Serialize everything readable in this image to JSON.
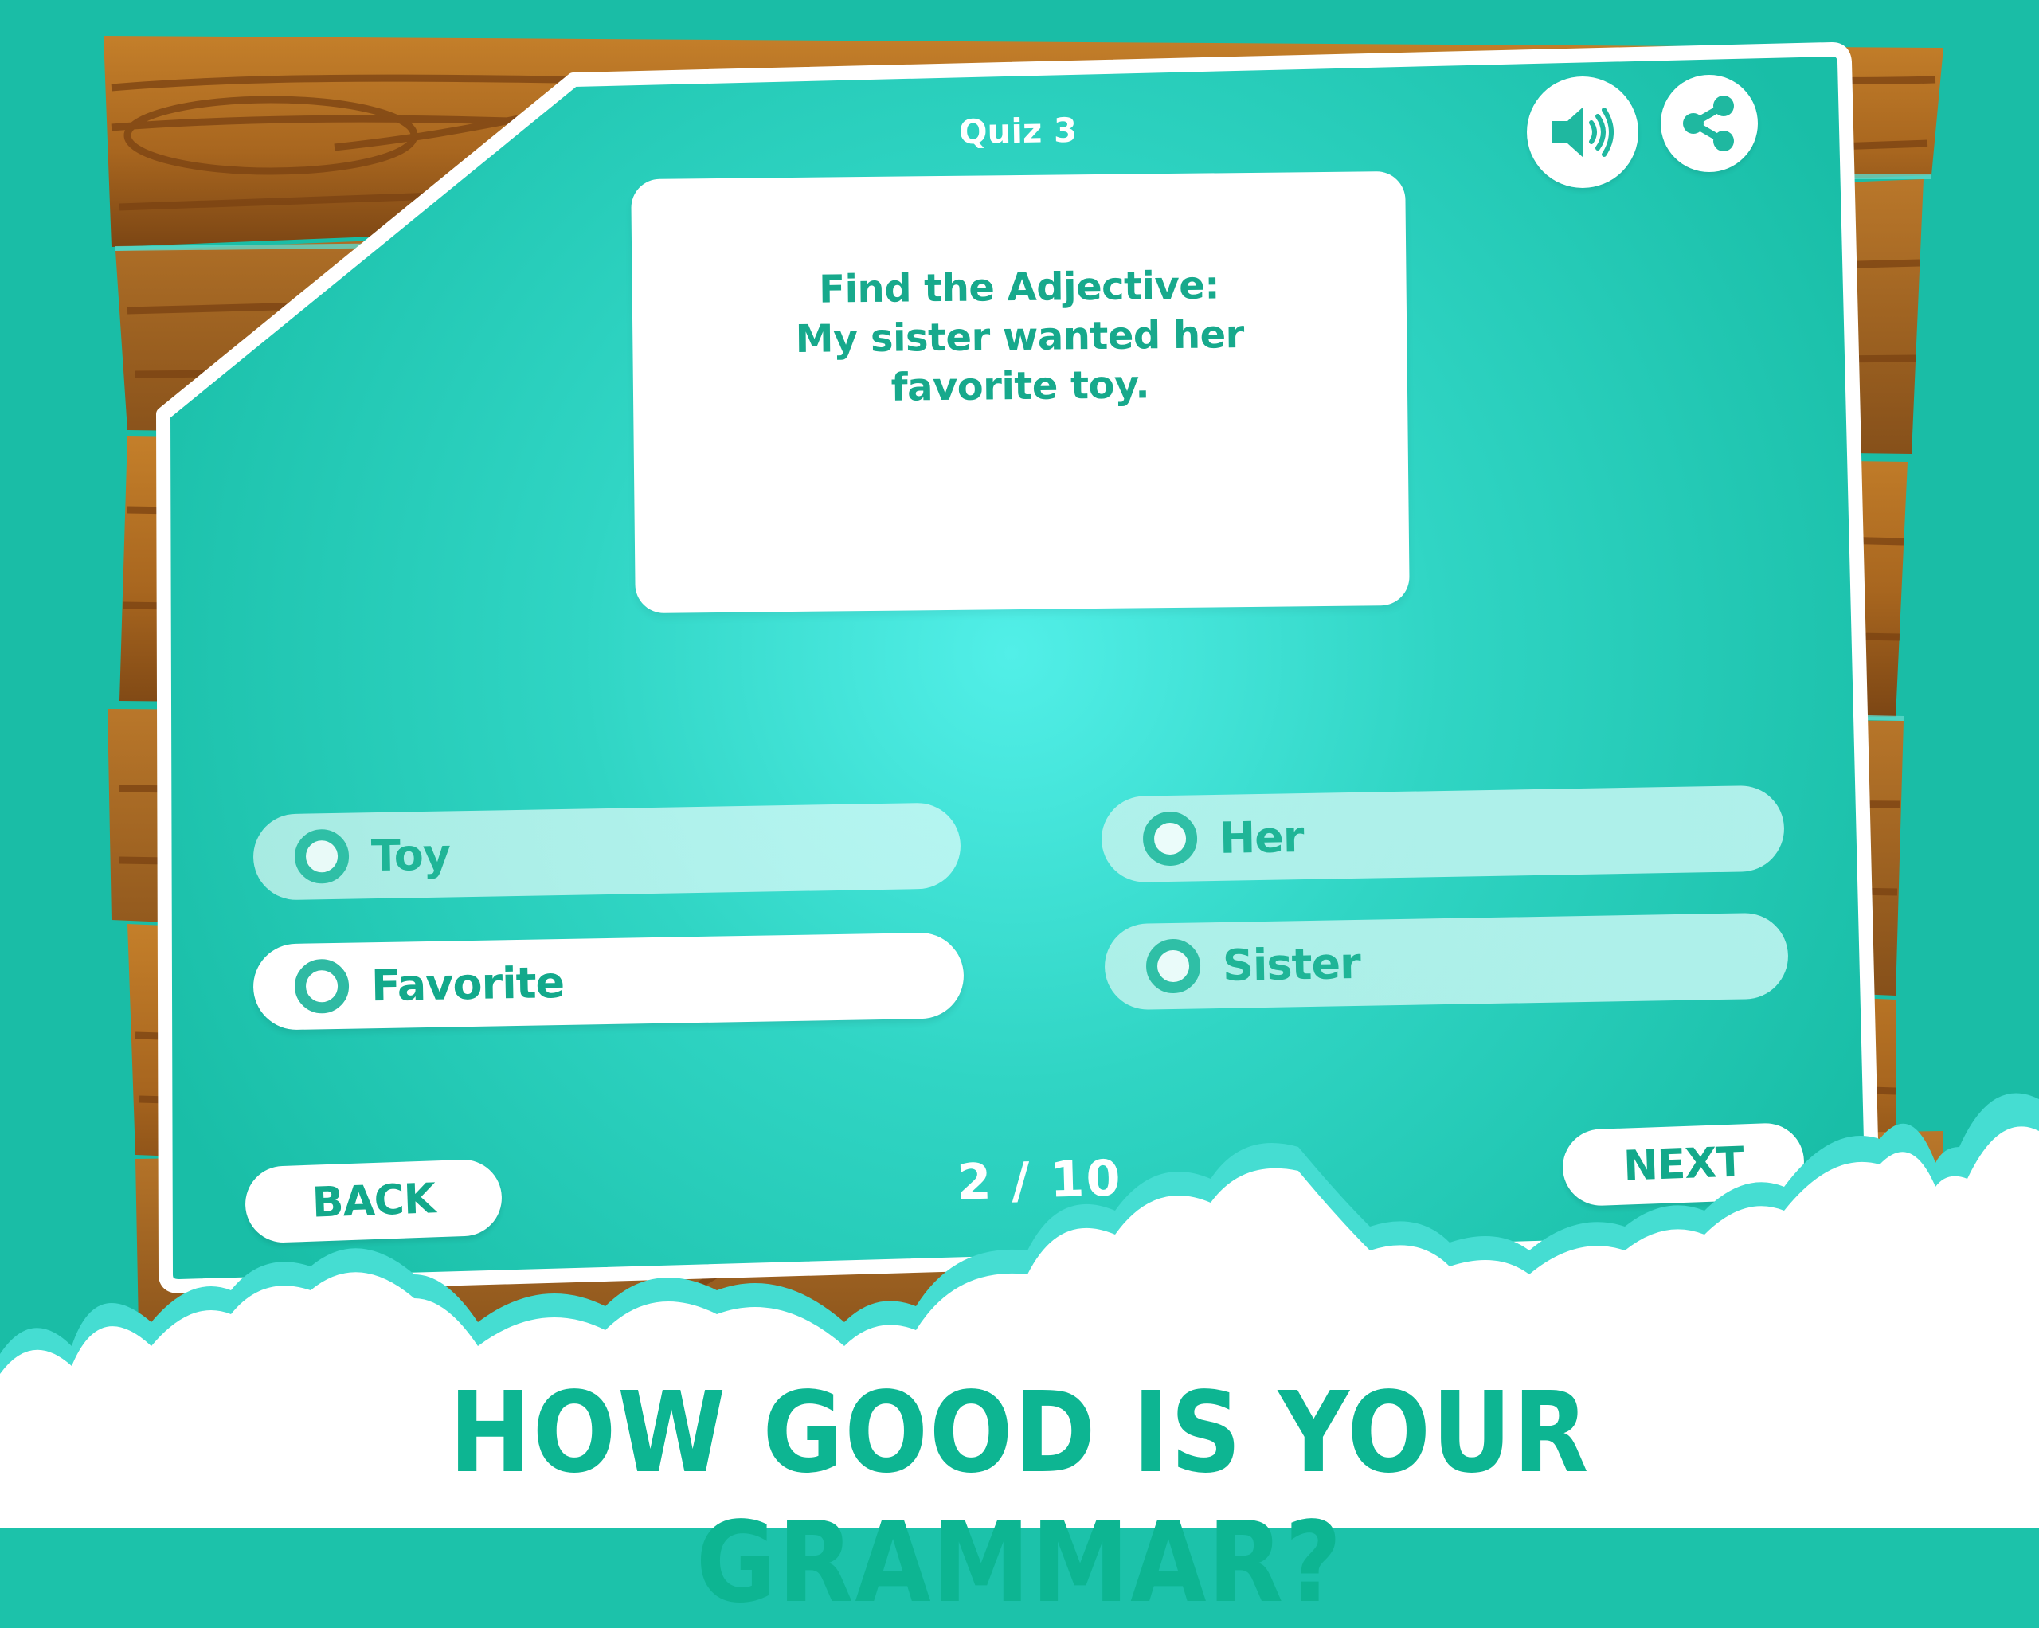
{
  "quiz": {
    "title": "Quiz 3",
    "question_lines": [
      "Find the Adjective:",
      "My sister wanted her",
      "favorite toy."
    ],
    "options": [
      {
        "label": "Toy",
        "selected": false
      },
      {
        "label": "Favorite",
        "selected": true
      },
      {
        "label": "Her",
        "selected": false
      },
      {
        "label": "Sister",
        "selected": false
      }
    ],
    "progress": {
      "current": 2,
      "total": 10,
      "text": "2 / 10"
    }
  },
  "controls": {
    "back_label": "BACK",
    "next_label": "NEXT",
    "sound_icon": "speaker-volume-icon",
    "share_icon": "share-icon"
  },
  "headline": "HOW GOOD IS YOUR GRAMMAR?",
  "colors": {
    "teal_bg": "#1cc2aa",
    "teal_glow": "#4eece4",
    "accent_text": "#13a98b",
    "wood": "#a8661f",
    "white": "#ffffff"
  }
}
